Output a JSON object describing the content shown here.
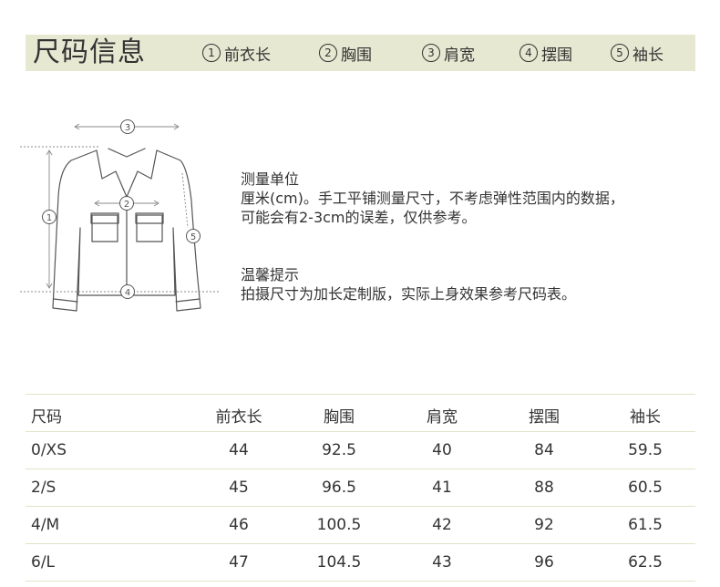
{
  "header": {
    "title": "尺码信息",
    "items": [
      {
        "num": "1",
        "label": "前衣长"
      },
      {
        "num": "2",
        "label": "胸围"
      },
      {
        "num": "3",
        "label": "肩宽"
      },
      {
        "num": "4",
        "label": "摆围"
      },
      {
        "num": "5",
        "label": "袖长"
      }
    ]
  },
  "diagram": {
    "markers": [
      "1",
      "2",
      "3",
      "4",
      "5"
    ]
  },
  "notes": {
    "measure_title": "测量单位",
    "measure_line1": "厘米(cm)。手工平铺测量尺寸，不考虑弹性范围内的数据，",
    "measure_line2": "可能会有2-3cm的误差，仅供参考。",
    "tip_title": "温馨提示",
    "tip_line1": "拍摄尺寸为加长定制版，实际上身效果参考尺码表。"
  },
  "table": {
    "headers": [
      "尺码",
      "前衣长",
      "胸围",
      "肩宽",
      "摆围",
      "袖长"
    ],
    "rows": [
      [
        "0/XS",
        "44",
        "92.5",
        "40",
        "84",
        "59.5"
      ],
      [
        "2/S",
        "45",
        "96.5",
        "41",
        "88",
        "60.5"
      ],
      [
        "4/M",
        "46",
        "100.5",
        "42",
        "92",
        "61.5"
      ],
      [
        "6/L",
        "47",
        "104.5",
        "43",
        "96",
        "62.5"
      ]
    ]
  }
}
